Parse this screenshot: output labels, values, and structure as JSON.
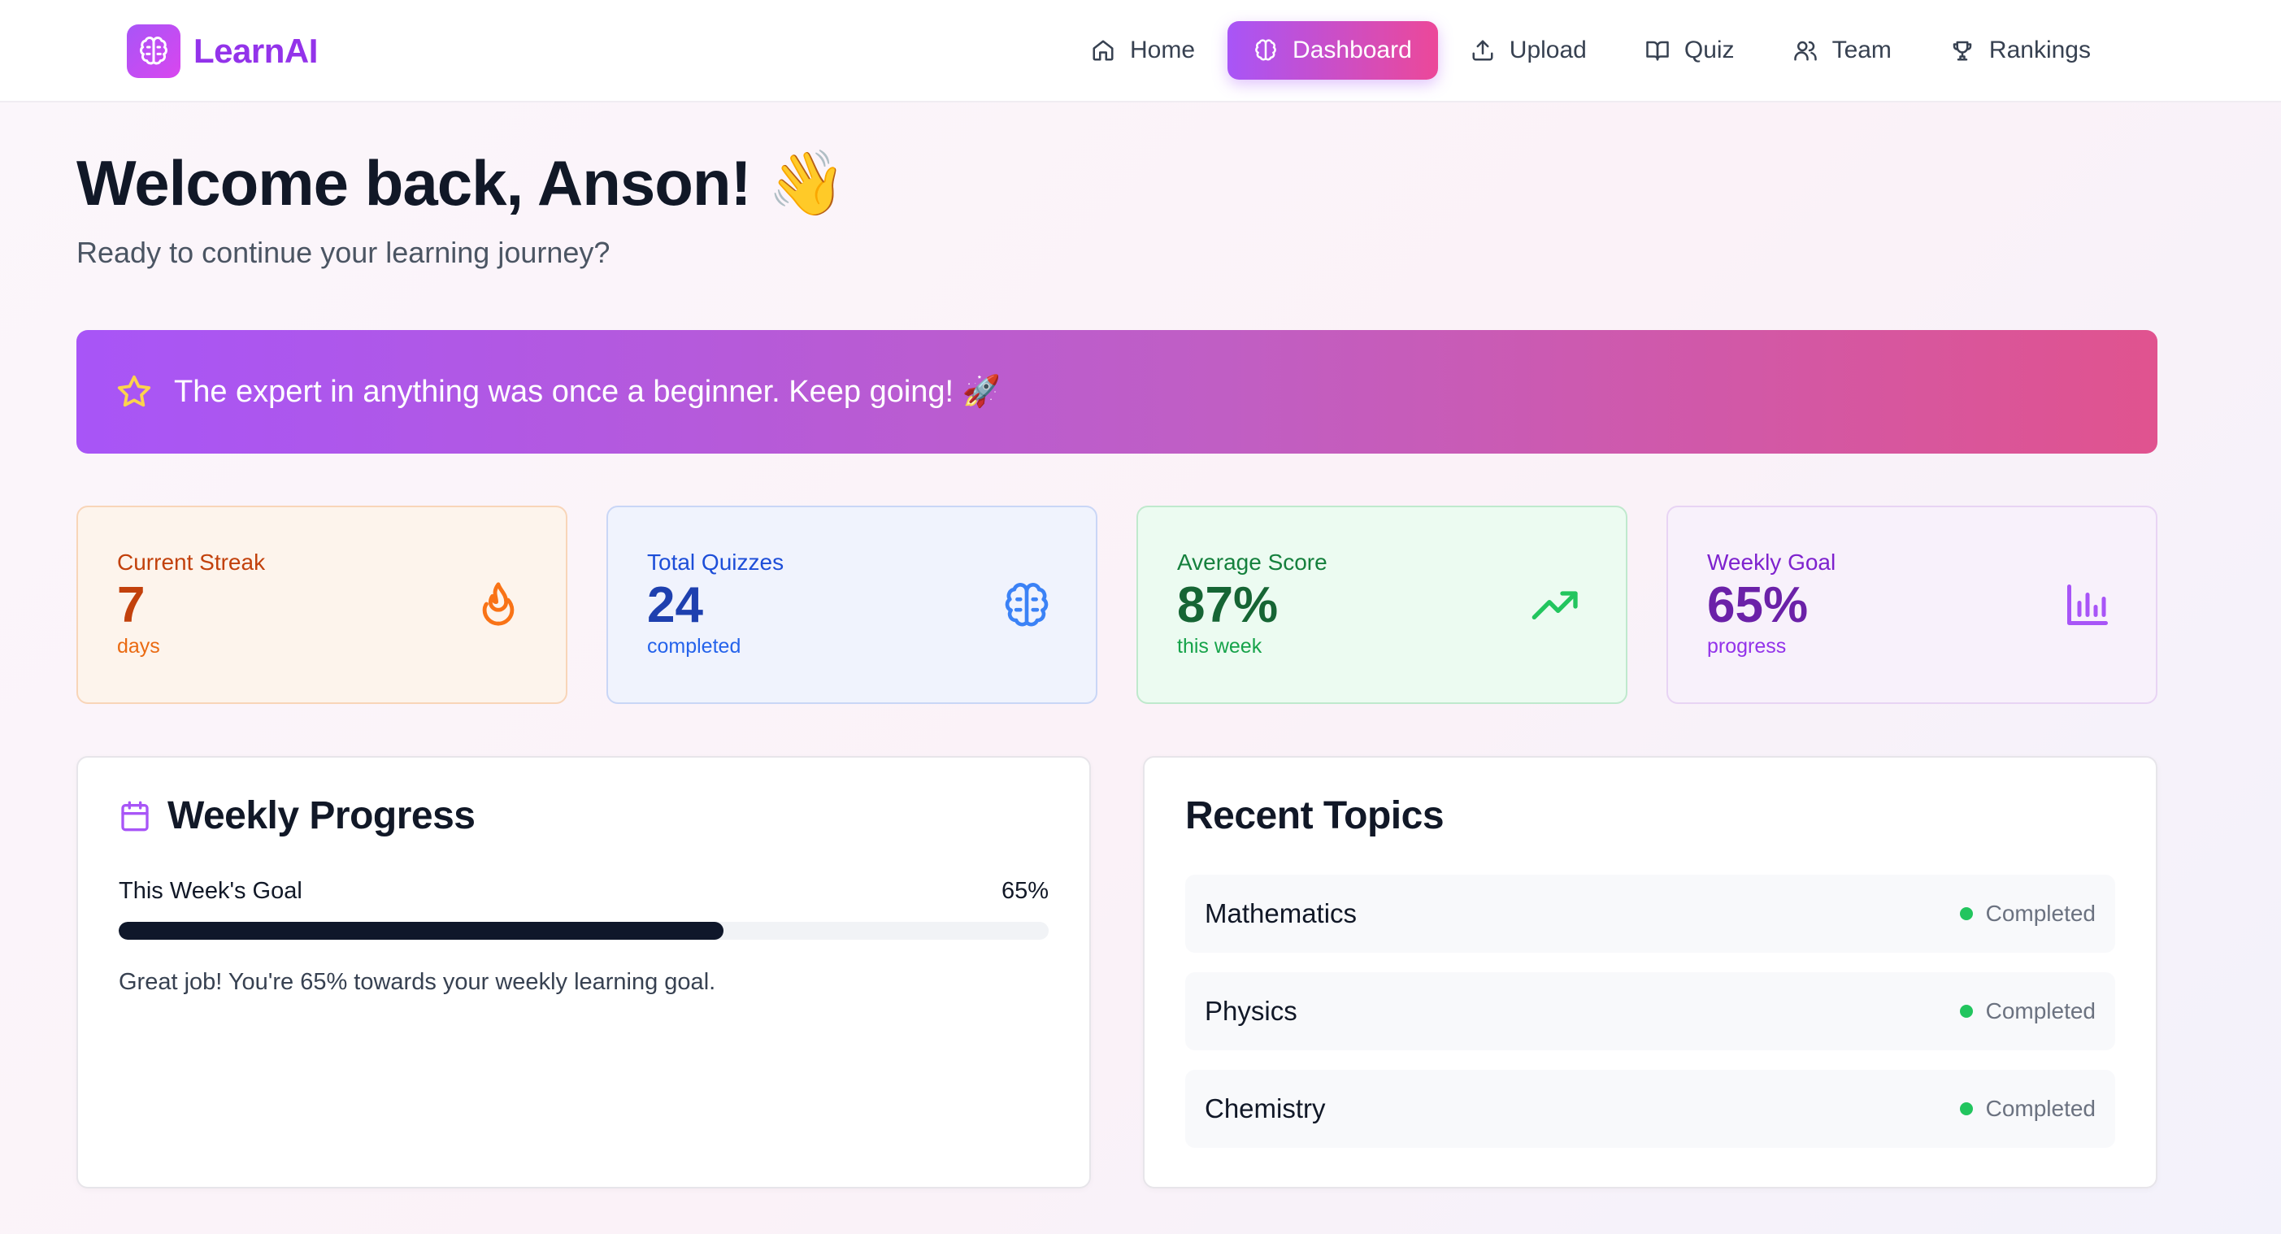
{
  "brand": {
    "name": "LearnAI"
  },
  "nav": {
    "items": [
      {
        "label": "Home",
        "icon": "home-icon",
        "active": false
      },
      {
        "label": "Dashboard",
        "icon": "brain-icon",
        "active": true
      },
      {
        "label": "Upload",
        "icon": "upload-icon",
        "active": false
      },
      {
        "label": "Quiz",
        "icon": "book-icon",
        "active": false
      },
      {
        "label": "Team",
        "icon": "users-icon",
        "active": false
      },
      {
        "label": "Rankings",
        "icon": "trophy-icon",
        "active": false
      }
    ]
  },
  "header": {
    "welcome": "Welcome back, Anson! 👋",
    "subtitle": "Ready to continue your learning journey?"
  },
  "banner": {
    "text": "The expert in anything was once a beginner. Keep going! 🚀",
    "icon": "star-icon"
  },
  "stats": [
    {
      "label": "Current Streak",
      "value": "7",
      "sub": "days",
      "icon": "flame-icon"
    },
    {
      "label": "Total Quizzes",
      "value": "24",
      "sub": "completed",
      "icon": "brain-icon"
    },
    {
      "label": "Average Score",
      "value": "87%",
      "sub": "this week",
      "icon": "trending-up-icon"
    },
    {
      "label": "Weekly Goal",
      "value": "65%",
      "sub": "progress",
      "icon": "bar-chart-icon"
    }
  ],
  "weekly_progress": {
    "title": "Weekly Progress",
    "goal_label": "This Week's Goal",
    "goal_percent_text": "65%",
    "progress": 0.65,
    "message": "Great job! You're 65% towards your weekly learning goal."
  },
  "recent_topics": {
    "title": "Recent Topics",
    "items": [
      {
        "name": "Mathematics",
        "status": "Completed"
      },
      {
        "name": "Physics",
        "status": "Completed"
      },
      {
        "name": "Chemistry",
        "status": "Completed"
      }
    ]
  },
  "colors": {
    "accent": "#a855f7",
    "accent_pink": "#ec4899",
    "status_green": "#22c55e"
  }
}
